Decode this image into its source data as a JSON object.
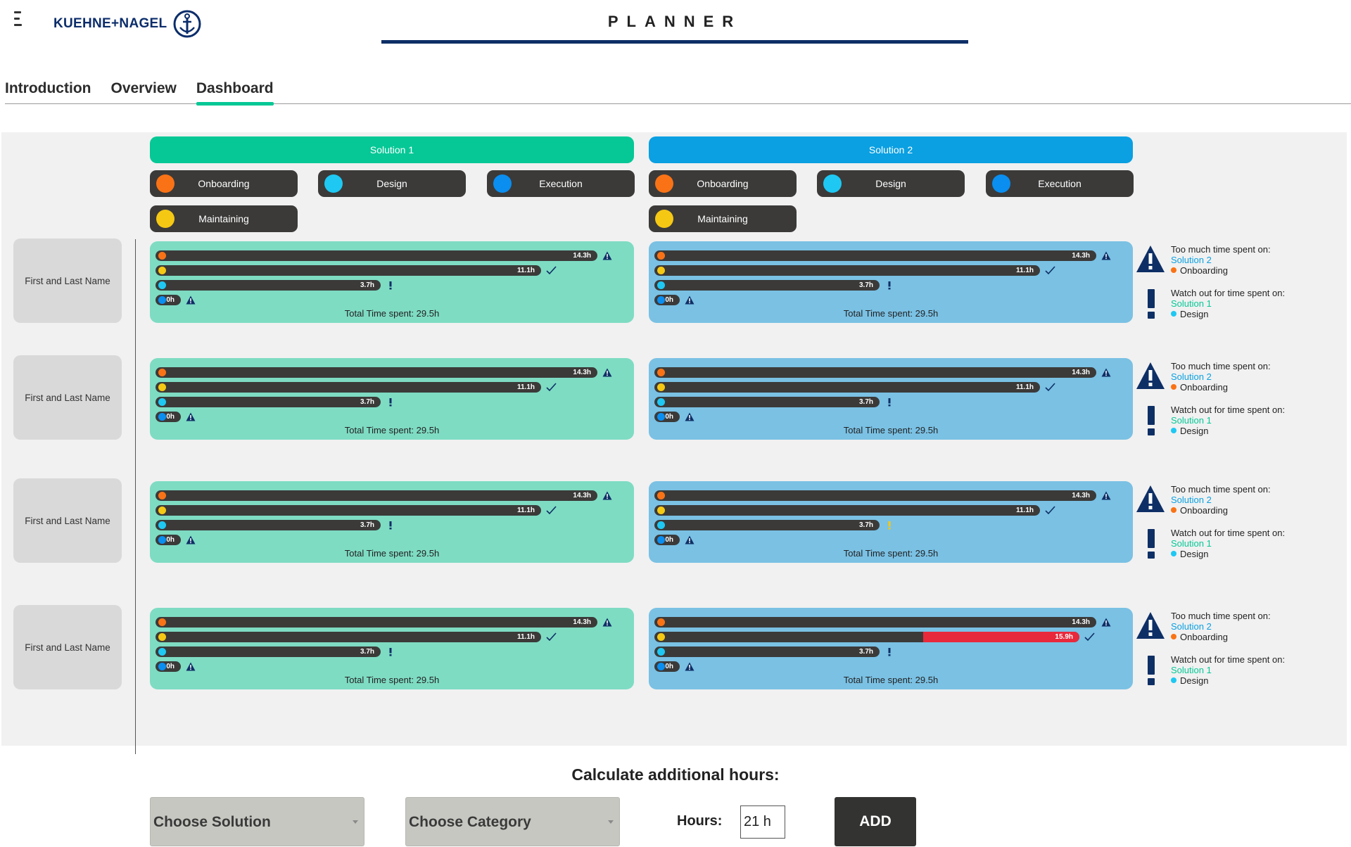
{
  "header": {
    "logo_text": "KUEHNE+NAGEL",
    "app_title": "PLANNER",
    "brand_color": "#0b2d6b"
  },
  "tabs": [
    {
      "label": "Introduction",
      "active": false
    },
    {
      "label": "Overview",
      "active": false
    },
    {
      "label": "Dashboard",
      "active": true
    }
  ],
  "solutions": [
    {
      "label": "Solution 1",
      "color": "#05c896"
    },
    {
      "label": "Solution 2",
      "color": "#0aa0e2"
    }
  ],
  "categories": [
    {
      "label": "Onboarding",
      "color": "#f97316"
    },
    {
      "label": "Design",
      "color": "#1ec8f3"
    },
    {
      "label": "Execution",
      "color": "#0a8ef0"
    },
    {
      "label": "Maintaining",
      "color": "#f5c814"
    }
  ],
  "rows": [
    {
      "name": "First and Last Name",
      "sol1": {
        "bars": [
          {
            "value": "14.3h",
            "status": "warning"
          },
          {
            "value": "11.1h",
            "status": "check"
          },
          {
            "value": "3.7h",
            "status": "exclaim"
          },
          {
            "value": "0h",
            "status": "warning"
          }
        ],
        "total": "Total Time spent: 29.5h"
      },
      "sol2": {
        "bars": [
          {
            "value": "14.3h",
            "status": "warning"
          },
          {
            "value": "11.1h",
            "status": "check"
          },
          {
            "value": "3.7h",
            "status": "exclaim"
          },
          {
            "value": "0h",
            "status": "warning"
          }
        ],
        "total": "Total Time spent: 29.5h"
      },
      "alert": {
        "too_much_label": "Too much time spent on:",
        "too_much_solution": "Solution 2",
        "too_much_category": "Onboarding",
        "watch_label": "Watch out for time spent on:",
        "watch_solution": "Solution 1",
        "watch_category": "Design"
      }
    },
    {
      "name": "First and Last Name",
      "sol1": {
        "bars": [
          {
            "value": "14.3h",
            "status": "warning"
          },
          {
            "value": "11.1h",
            "status": "check"
          },
          {
            "value": "3.7h",
            "status": "exclaim"
          },
          {
            "value": "0h",
            "status": "warning"
          }
        ],
        "total": "Total Time spent: 29.5h"
      },
      "sol2": {
        "bars": [
          {
            "value": "14.3h",
            "status": "warning"
          },
          {
            "value": "11.1h",
            "status": "check"
          },
          {
            "value": "3.7h",
            "status": "exclaim"
          },
          {
            "value": "0h",
            "status": "warning"
          }
        ],
        "total": "Total Time spent: 29.5h"
      },
      "alert": {
        "too_much_label": "Too much time spent on:",
        "too_much_solution": "Solution 2",
        "too_much_category": "Onboarding",
        "watch_label": "Watch out for time spent on:",
        "watch_solution": "Solution 1",
        "watch_category": "Design"
      }
    },
    {
      "name": "First and Last Name",
      "sol1": {
        "bars": [
          {
            "value": "14.3h",
            "status": "warning"
          },
          {
            "value": "11.1h",
            "status": "check"
          },
          {
            "value": "3.7h",
            "status": "exclaim"
          },
          {
            "value": "0h",
            "status": "warning"
          }
        ],
        "total": "Total Time spent: 29.5h"
      },
      "sol2": {
        "bars": [
          {
            "value": "14.3h",
            "status": "warning"
          },
          {
            "value": "11.1h",
            "status": "check"
          },
          {
            "value": "3.7h",
            "status": "exclaim-yellow"
          },
          {
            "value": "0h",
            "status": "warning"
          }
        ],
        "total": "Total Time spent: 29.5h"
      },
      "alert": {
        "too_much_label": "Too much time spent on:",
        "too_much_solution": "Solution 2",
        "too_much_category": "Onboarding",
        "watch_label": "Watch out for time spent on:",
        "watch_solution": "Solution 1",
        "watch_category": "Design"
      }
    },
    {
      "name": "First and Last Name",
      "sol1": {
        "bars": [
          {
            "value": "14.3h",
            "status": "warning"
          },
          {
            "value": "11.1h",
            "status": "check"
          },
          {
            "value": "3.7h",
            "status": "exclaim"
          },
          {
            "value": "0h",
            "status": "warning"
          }
        ],
        "total": "Total Time spent: 29.5h"
      },
      "sol2": {
        "bars": [
          {
            "value": "14.3h",
            "status": "warning"
          },
          {
            "value": "15.9h",
            "status": "check"
          },
          {
            "value": "3.7h",
            "status": "exclaim"
          },
          {
            "value": "0h",
            "status": "warning"
          }
        ],
        "total": "Total Time spent: 29.5h"
      },
      "alert": {
        "too_much_label": "Too much time spent on:",
        "too_much_solution": "Solution 2",
        "too_much_category": "Onboarding",
        "watch_label": "Watch out for time spent on:",
        "watch_solution": "Solution 1",
        "watch_category": "Design"
      }
    }
  ],
  "calculator": {
    "title": "Calculate additional hours:",
    "solution_select": "Choose Solution",
    "category_select": "Choose Category",
    "hours_label": "Hours:",
    "hours_value": "21  h",
    "add_label": "ADD"
  },
  "colors": {
    "over_limit": "#e8293b",
    "warning_icon": "#0e2f66",
    "check_icon": "#0e2f66",
    "exclaim_yellow": "#f5c814"
  }
}
